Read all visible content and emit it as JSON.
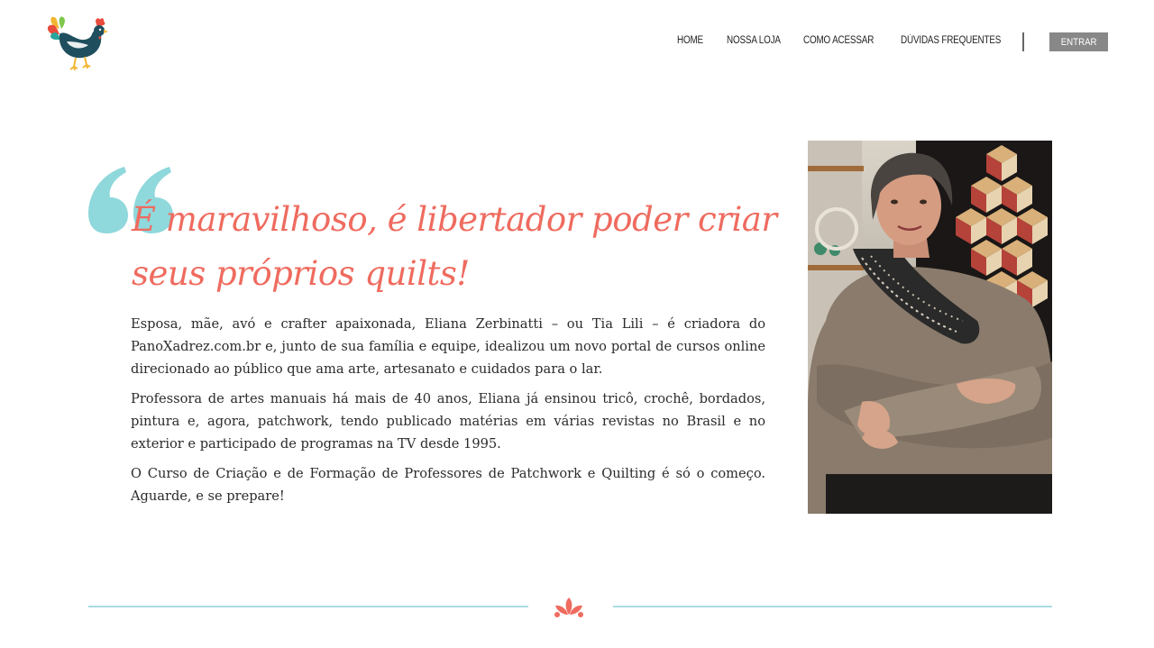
{
  "header": {
    "logo_alt": "rooster-logo",
    "nav": [
      {
        "label": "HOME"
      },
      {
        "label": "NOSSA LOJA"
      },
      {
        "label": "COMO ACESSAR"
      },
      {
        "label": "DÚVIDAS FREQUENTES"
      }
    ],
    "login_label": "ENTRAR"
  },
  "hero": {
    "headline": "É maravilhoso, é libertador poder criar seus próprios quilts!",
    "paragraphs": [
      "Esposa, mãe, avó e crafter apaixonada, Eliana Zerbinatti – ou Tia Lili – é criadora do PanoXadrez.com.br e, junto de sua família e equipe, idealizou um novo portal de cursos online direcionado ao público que ama arte, artesanato e cuidados para o lar.",
      "Professora de artes manuais há mais de 40 anos, Eliana já ensinou tricô, crochê, bordados, pintura e, agora, patchwork, tendo publicado matérias em várias revistas no Brasil e no exterior e participado de programas na TV desde 1995.",
      "O Curso de Criação e de Formação de Professores de Patchwork e Quilting é só o começo. Aguarde, e se prepare!"
    ]
  },
  "colors": {
    "headline": "#ef6b5f",
    "quote_mark": "#8fd8dc",
    "divider": "#a8dde0",
    "ornament": "#ef6b5f",
    "login_button": "#888888"
  },
  "icons": {
    "logo": "rooster-icon",
    "quote": "quote-mark-icon",
    "ornament": "flower-ornament-icon"
  }
}
